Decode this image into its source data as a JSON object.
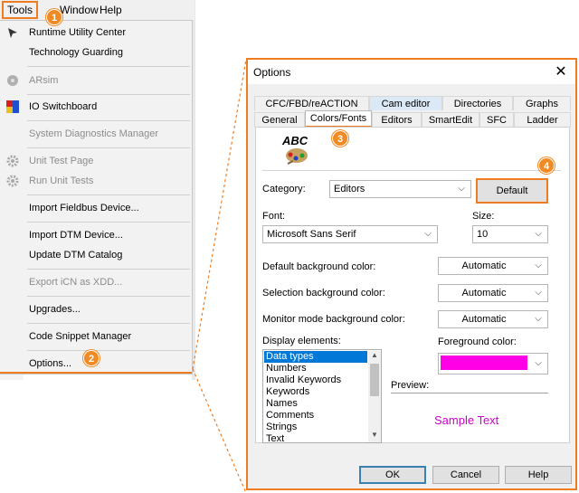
{
  "menubar": {
    "items": [
      "Tools",
      "Window",
      "Help"
    ]
  },
  "tools_menu": {
    "items": [
      {
        "label": "Runtime Utility Center",
        "disabled": false,
        "icon": "runtime-icon"
      },
      {
        "label": "Technology Guarding",
        "disabled": false,
        "icon": ""
      },
      {
        "label": "ARsim",
        "disabled": true,
        "icon": "arsim-icon"
      },
      {
        "label": "IO Switchboard",
        "disabled": false,
        "icon": "io-switchboard-icon"
      },
      {
        "label": "System Diagnostics Manager",
        "disabled": true,
        "icon": ""
      },
      {
        "label": "Unit Test Page",
        "disabled": true,
        "icon": "gear-icon"
      },
      {
        "label": "Run Unit Tests",
        "disabled": true,
        "icon": "gear-icon"
      },
      {
        "label": "Import Fieldbus Device...",
        "disabled": false,
        "icon": ""
      },
      {
        "label": "Import DTM Device...",
        "disabled": false,
        "icon": ""
      },
      {
        "label": "Update DTM Catalog",
        "disabled": false,
        "icon": ""
      },
      {
        "label": "Export iCN as XDD...",
        "disabled": true,
        "icon": ""
      },
      {
        "label": "Upgrades...",
        "disabled": false,
        "icon": ""
      },
      {
        "label": "Code Snippet Manager",
        "disabled": false,
        "icon": ""
      },
      {
        "label": "Options...",
        "disabled": false,
        "icon": ""
      }
    ]
  },
  "badges": [
    "1",
    "2",
    "3",
    "4"
  ],
  "dialog": {
    "title": "Options",
    "tabs_row1": [
      "CFC/FBD/reACTION",
      "Cam editor",
      "Directories",
      "Graphs"
    ],
    "tabs_row2": [
      "General",
      "Colors/Fonts",
      "Editors",
      "SmartEdit",
      "SFC",
      "Ladder"
    ],
    "logo_text": "ABC",
    "category_label": "Category:",
    "category_value": "Editors",
    "default_button": "Default",
    "font_label": "Font:",
    "font_value": "Microsoft Sans Serif",
    "size_label": "Size:",
    "size_value": "10",
    "default_bg_label": "Default background color:",
    "default_bg_value": "Automatic",
    "selection_bg_label": "Selection background color:",
    "selection_bg_value": "Automatic",
    "monitor_bg_label": "Monitor mode background color:",
    "monitor_bg_value": "Automatic",
    "display_elements_label": "Display elements:",
    "display_elements": [
      "Data types",
      "Numbers",
      "Invalid Keywords",
      "Keywords",
      "Names",
      "Comments",
      "Strings",
      "Text"
    ],
    "foreground_label": "Foreground color:",
    "foreground_color": "#ff00e6",
    "preview_label": "Preview:",
    "sample_text": "Sample Text",
    "sample_color": "#cc00cc",
    "ok": "OK",
    "cancel": "Cancel",
    "help": "Help"
  },
  "colors": {
    "highlight": "#ee7d22",
    "selection": "#0078d7"
  }
}
